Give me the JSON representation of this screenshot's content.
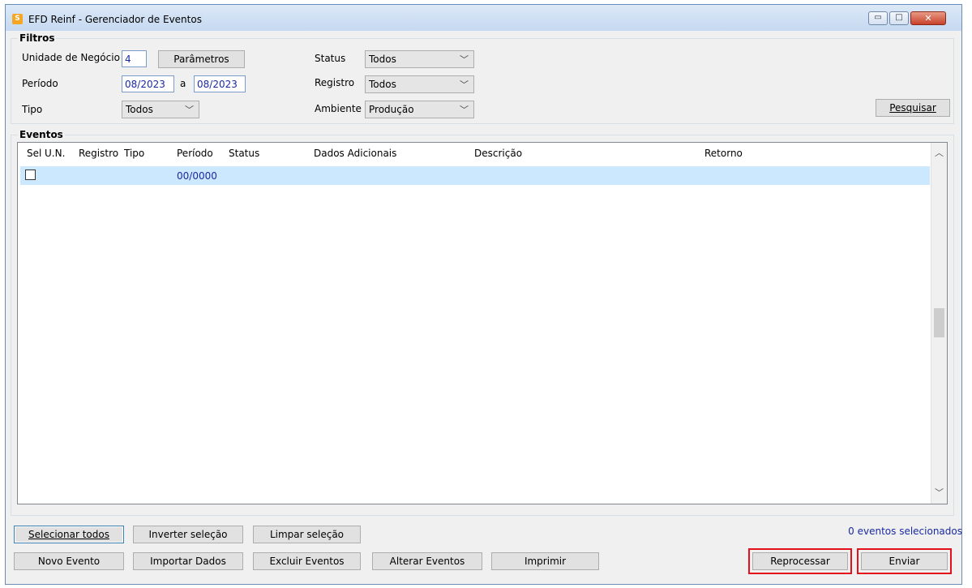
{
  "window": {
    "title": "EFD Reinf - Gerenciador de Eventos",
    "min_glyph": "▭",
    "max_glyph": "□",
    "close_glyph": "✕"
  },
  "filtros": {
    "title": "Filtros",
    "unidade_label": "Unidade de Negócio",
    "unidade_value": "4",
    "parametros_button": "Parâmetros",
    "periodo_label": "Período",
    "periodo_inicio": "08/2023",
    "periodo_sep": "a",
    "periodo_fim": "08/2023",
    "tipo_label": "Tipo",
    "tipo_value": "Todos",
    "status_label": "Status",
    "status_value": "Todos",
    "registro_label": "Registro",
    "registro_value": "Todos",
    "ambiente_label": "Ambiente",
    "ambiente_value": "Produção",
    "pesquisar_button": "Pesquisar"
  },
  "eventos": {
    "title": "Eventos",
    "columns": [
      "Sel",
      "U.N.",
      "Registro",
      "Tipo",
      "Período",
      "Status",
      "Dados Adicionais",
      "Descrição",
      "Retorno"
    ],
    "rows": [
      {
        "sel": false,
        "un": "",
        "registro": "",
        "tipo": "",
        "periodo": "00/0000",
        "status": "",
        "dados": "",
        "descricao": "",
        "retorno": ""
      }
    ]
  },
  "actions": {
    "selecionar_todos": "Selecionar todos",
    "inverter_selecao": "Inverter seleção",
    "limpar_selecao": "Limpar seleção",
    "novo_evento": "Novo Evento",
    "importar_dados": "Importar Dados",
    "excluir_eventos": "Excluir Eventos",
    "alterar_eventos": "Alterar Eventos",
    "imprimir": "Imprimir",
    "reprocessar": "Reprocessar",
    "enviar": "Enviar",
    "selected_count": "0 eventos selecionados"
  },
  "colors": {
    "selected_row": "#cce8ff",
    "highlight_border": "#e2111b",
    "value_text": "#1a2aa0"
  },
  "icons": {
    "dropdown": "chevron-down-icon",
    "scroll_up": "chevron-up-icon",
    "scroll_down": "chevron-down-icon"
  }
}
